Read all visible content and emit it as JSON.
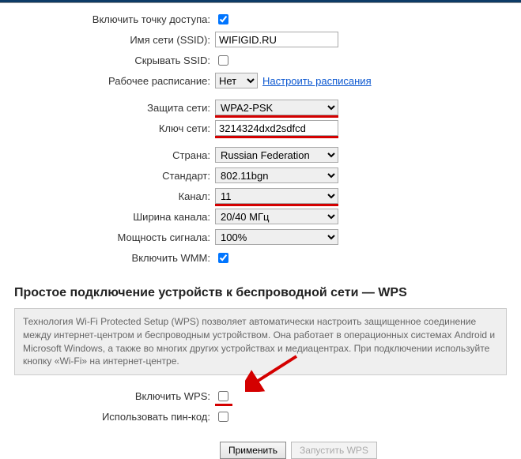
{
  "fields": {
    "enable_ap": {
      "label": "Включить точку доступа:",
      "checked": true
    },
    "ssid": {
      "label": "Имя сети (SSID):",
      "value": "WIFIGID.RU"
    },
    "hide_ssid": {
      "label": "Скрывать SSID:",
      "checked": false
    },
    "schedule": {
      "label": "Рабочее расписание:",
      "value": "Нет",
      "link": "Настроить расписания"
    },
    "security": {
      "label": "Защита сети:",
      "value": "WPA2-PSK"
    },
    "key": {
      "label": "Ключ сети:",
      "value": "3214324dxd2sdfcd"
    },
    "country": {
      "label": "Страна:",
      "value": "Russian Federation"
    },
    "standard": {
      "label": "Стандарт:",
      "value": "802.11bgn"
    },
    "channel": {
      "label": "Канал:",
      "value": "11"
    },
    "width": {
      "label": "Ширина канала:",
      "value": "20/40 МГц"
    },
    "power": {
      "label": "Мощность сигнала:",
      "value": "100%"
    },
    "wmm": {
      "label": "Включить WMM:",
      "checked": true
    }
  },
  "wps": {
    "title": "Простое подключение устройств к беспроводной сети — WPS",
    "info": "Технология Wi-Fi Protected Setup (WPS) позволяет автоматически настроить защищенное соединение между интернет-центром и беспроводным устройством. Она работает в операционных системах Android и Microsoft Windows, а также во многих других устройствах и медиацентрах. При подключении используйте кнопку «Wi-Fi» на интернет-центре.",
    "enable": {
      "label": "Включить WPS:",
      "checked": false
    },
    "use_pin": {
      "label": "Использовать пин-код:",
      "checked": false
    }
  },
  "buttons": {
    "apply": "Применить",
    "run_wps": "Запустить WPS"
  }
}
